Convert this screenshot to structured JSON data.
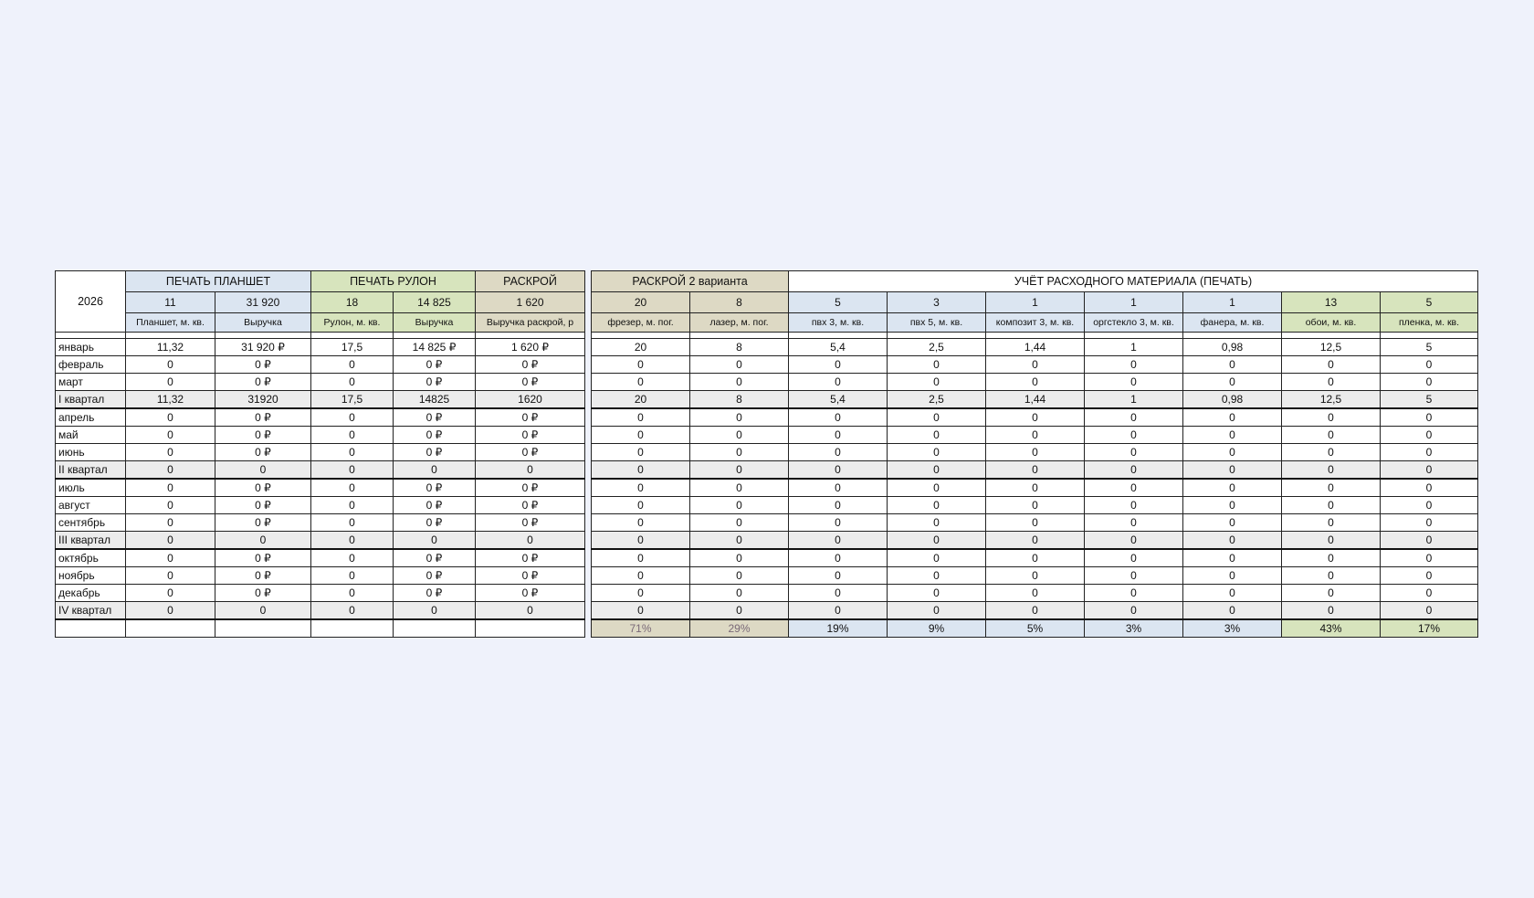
{
  "year": "2026",
  "left_groups": [
    {
      "label": "ПЕЧАТЬ ПЛАНШЕТ",
      "color": "blue"
    },
    {
      "label": "ПЕЧАТЬ РУЛОН",
      "color": "green"
    },
    {
      "label": "РАСКРОЙ",
      "color": "tan"
    }
  ],
  "right_groups": [
    {
      "label": "РАСКРОЙ 2 варианта",
      "color": "tan"
    },
    {
      "label": "УЧЁТ РАСХОДНОГО МАТЕРИАЛА (ПЕЧАТЬ)",
      "color": "white"
    }
  ],
  "left_columns": [
    {
      "total": "11",
      "name": "Планшет, м. кв.",
      "color": "blue"
    },
    {
      "total": "31 920",
      "name": "Выручка",
      "color": "blue"
    },
    {
      "total": "18",
      "name": "Рулон, м. кв.",
      "color": "green"
    },
    {
      "total": "14 825",
      "name": "Выручка",
      "color": "green"
    },
    {
      "total": "1 620",
      "name": "Выручка раскрой, р",
      "color": "tan"
    }
  ],
  "right_columns": [
    {
      "total": "20",
      "name": "фрезер, м. пог.",
      "color": "tan",
      "pct": "71%"
    },
    {
      "total": "8",
      "name": "лазер, м. пог.",
      "color": "tan",
      "pct": "29%"
    },
    {
      "total": "5",
      "name": "пвх 3, м. кв.",
      "color": "blue",
      "pct": "19%"
    },
    {
      "total": "3",
      "name": "пвх 5, м. кв.",
      "color": "blue",
      "pct": "9%"
    },
    {
      "total": "1",
      "name": "композит 3,  м. кв.",
      "color": "blue",
      "pct": "5%"
    },
    {
      "total": "1",
      "name": "оргстекло 3,  м. кв.",
      "color": "blue",
      "pct": "3%"
    },
    {
      "total": "1",
      "name": "фанера,  м. кв.",
      "color": "blue",
      "pct": "3%"
    },
    {
      "total": "13",
      "name": "обои,  м. кв.",
      "color": "green",
      "pct": "43%"
    },
    {
      "total": "5",
      "name": "пленка,  м. кв.",
      "color": "green",
      "pct": "17%"
    }
  ],
  "rows": [
    {
      "label": "январь",
      "quarter": false,
      "left": [
        "11,32",
        "31 920 ₽",
        "17,5",
        "14 825 ₽",
        "1 620 ₽"
      ],
      "right": [
        "20",
        "8",
        "5,4",
        "2,5",
        "1,44",
        "1",
        "0,98",
        "12,5",
        "5"
      ]
    },
    {
      "label": "февраль",
      "quarter": false,
      "left": [
        "0",
        "0 ₽",
        "0",
        "0 ₽",
        "0 ₽"
      ],
      "right": [
        "0",
        "0",
        "0",
        "0",
        "0",
        "0",
        "0",
        "0",
        "0"
      ]
    },
    {
      "label": "март",
      "quarter": false,
      "left": [
        "0",
        "0 ₽",
        "0",
        "0 ₽",
        "0 ₽"
      ],
      "right": [
        "0",
        "0",
        "0",
        "0",
        "0",
        "0",
        "0",
        "0",
        "0"
      ]
    },
    {
      "label": "I квартал",
      "quarter": true,
      "left": [
        "11,32",
        "31920",
        "17,5",
        "14825",
        "1620"
      ],
      "right": [
        "20",
        "8",
        "5,4",
        "2,5",
        "1,44",
        "1",
        "0,98",
        "12,5",
        "5"
      ]
    },
    {
      "label": "апрель",
      "quarter": false,
      "left": [
        "0",
        "0 ₽",
        "0",
        "0 ₽",
        "0 ₽"
      ],
      "right": [
        "0",
        "0",
        "0",
        "0",
        "0",
        "0",
        "0",
        "0",
        "0"
      ]
    },
    {
      "label": "май",
      "quarter": false,
      "left": [
        "0",
        "0 ₽",
        "0",
        "0 ₽",
        "0 ₽"
      ],
      "right": [
        "0",
        "0",
        "0",
        "0",
        "0",
        "0",
        "0",
        "0",
        "0"
      ]
    },
    {
      "label": "июнь",
      "quarter": false,
      "left": [
        "0",
        "0 ₽",
        "0",
        "0 ₽",
        "0 ₽"
      ],
      "right": [
        "0",
        "0",
        "0",
        "0",
        "0",
        "0",
        "0",
        "0",
        "0"
      ]
    },
    {
      "label": "II квартал",
      "quarter": true,
      "left": [
        "0",
        "0",
        "0",
        "0",
        "0"
      ],
      "right": [
        "0",
        "0",
        "0",
        "0",
        "0",
        "0",
        "0",
        "0",
        "0"
      ]
    },
    {
      "label": "июль",
      "quarter": false,
      "left": [
        "0",
        "0 ₽",
        "0",
        "0 ₽",
        "0 ₽"
      ],
      "right": [
        "0",
        "0",
        "0",
        "0",
        "0",
        "0",
        "0",
        "0",
        "0"
      ]
    },
    {
      "label": "август",
      "quarter": false,
      "left": [
        "0",
        "0 ₽",
        "0",
        "0 ₽",
        "0 ₽"
      ],
      "right": [
        "0",
        "0",
        "0",
        "0",
        "0",
        "0",
        "0",
        "0",
        "0"
      ]
    },
    {
      "label": "сентябрь",
      "quarter": false,
      "left": [
        "0",
        "0 ₽",
        "0",
        "0 ₽",
        "0 ₽"
      ],
      "right": [
        "0",
        "0",
        "0",
        "0",
        "0",
        "0",
        "0",
        "0",
        "0"
      ]
    },
    {
      "label": "III квартал",
      "quarter": true,
      "left": [
        "0",
        "0",
        "0",
        "0",
        "0"
      ],
      "right": [
        "0",
        "0",
        "0",
        "0",
        "0",
        "0",
        "0",
        "0",
        "0"
      ]
    },
    {
      "label": "октябрь",
      "quarter": false,
      "left": [
        "0",
        "0 ₽",
        "0",
        "0 ₽",
        "0 ₽"
      ],
      "right": [
        "0",
        "0",
        "0",
        "0",
        "0",
        "0",
        "0",
        "0",
        "0"
      ]
    },
    {
      "label": "ноябрь",
      "quarter": false,
      "left": [
        "0",
        "0 ₽",
        "0",
        "0 ₽",
        "0 ₽"
      ],
      "right": [
        "0",
        "0",
        "0",
        "0",
        "0",
        "0",
        "0",
        "0",
        "0"
      ]
    },
    {
      "label": "декабрь",
      "quarter": false,
      "left": [
        "0",
        "0 ₽",
        "0",
        "0 ₽",
        "0 ₽"
      ],
      "right": [
        "0",
        "0",
        "0",
        "0",
        "0",
        "0",
        "0",
        "0",
        "0"
      ]
    },
    {
      "label": "IV квартал",
      "quarter": true,
      "left": [
        "0",
        "0",
        "0",
        "0",
        "0"
      ],
      "right": [
        "0",
        "0",
        "0",
        "0",
        "0",
        "0",
        "0",
        "0",
        "0"
      ]
    }
  ],
  "colors": {
    "blue": "#dbe5f1",
    "green": "#d7e4bd",
    "tan": "#ddd9c4",
    "background": "#eff2fb"
  }
}
